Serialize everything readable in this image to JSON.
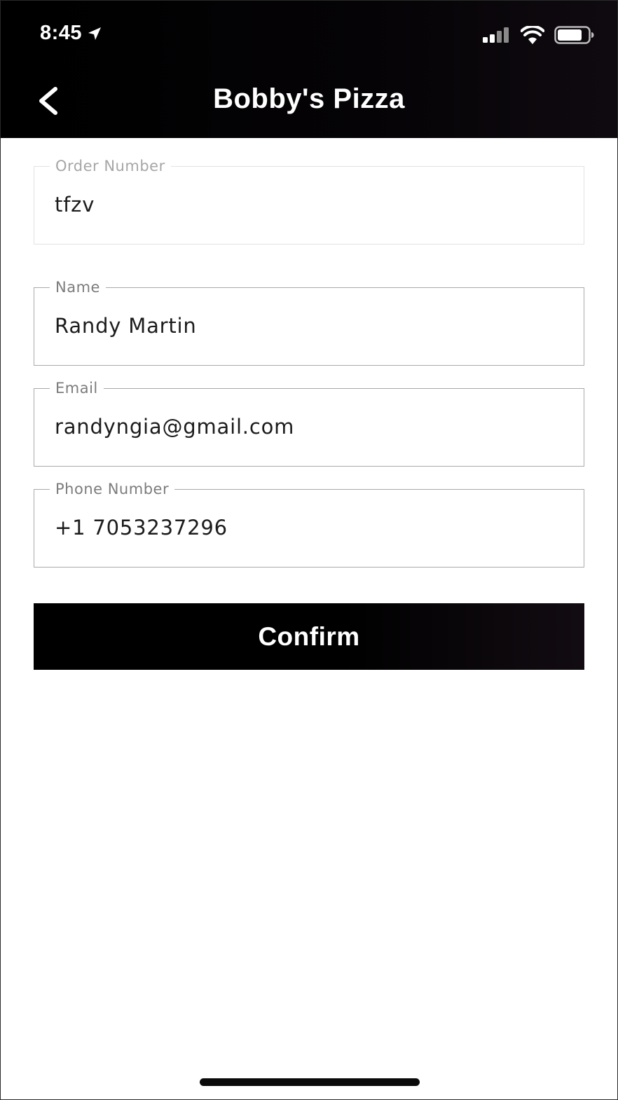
{
  "status_bar": {
    "time": "8:45",
    "icons": [
      "location-arrow-icon",
      "signal-icon",
      "wifi-icon",
      "battery-icon"
    ]
  },
  "header": {
    "title": "Bobby's Pizza",
    "back_icon": "chevron-left-icon"
  },
  "form": {
    "order_number": {
      "label": "Order Number",
      "value": "tfzv",
      "disabled": true
    },
    "name": {
      "label": "Name",
      "value": "Randy Martin"
    },
    "email": {
      "label": "Email",
      "value": "randyngia@gmail.com"
    },
    "phone": {
      "label": "Phone Number",
      "value": "+1 7053237296"
    }
  },
  "confirm_label": "Confirm",
  "colors": {
    "header_bg": "#000000",
    "button_bg": "#000000",
    "border": "#a9a9a9",
    "label": "#7c7c7c"
  }
}
